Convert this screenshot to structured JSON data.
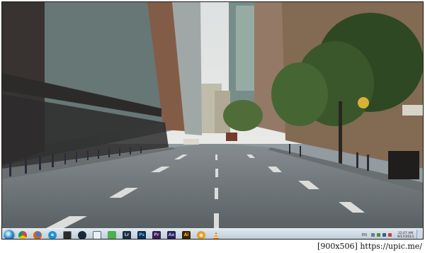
{
  "wallpaper": {
    "scene": "city-street-perspective"
  },
  "taskbar": {
    "start_icon": "windows-orb-icon",
    "pinned_icons": [
      {
        "name": "chrome-icon",
        "glyph": "",
        "color": "#db4437"
      },
      {
        "name": "firefox-icon",
        "glyph": "",
        "color": "#e66000"
      },
      {
        "name": "internet-explorer-icon",
        "glyph": "e",
        "color": "#1e90d6"
      },
      {
        "name": "app-icon-dark",
        "glyph": "",
        "color": "#2b2b2b"
      },
      {
        "name": "steam-icon",
        "glyph": "",
        "color": "#1b2838"
      },
      {
        "name": "window-app-icon",
        "glyph": "",
        "color": "#5d6b78"
      },
      {
        "name": "green-app-icon",
        "glyph": "",
        "color": "#4caf50"
      },
      {
        "name": "lightroom-icon",
        "glyph": "Lr",
        "color": "#1f2f3f"
      },
      {
        "name": "photoshop-icon",
        "glyph": "Ps",
        "color": "#0f4c8a"
      },
      {
        "name": "premiere-icon",
        "glyph": "Pr",
        "color": "#4a2a6a"
      },
      {
        "name": "after-effects-icon",
        "glyph": "Ae",
        "color": "#4a3a7a"
      },
      {
        "name": "illustrator-icon",
        "glyph": "Ai",
        "color": "#3a2a0a"
      },
      {
        "name": "app-icon-round-orange",
        "glyph": "",
        "color": "#e8a020"
      },
      {
        "name": "vlc-icon",
        "glyph": "",
        "color": "#f08000"
      }
    ],
    "tray": {
      "language": "EN",
      "clock_time": "12:07 AM",
      "clock_date": "9/17/2013"
    }
  },
  "watermark": {
    "text": "[900x506] https://upic.me/"
  }
}
